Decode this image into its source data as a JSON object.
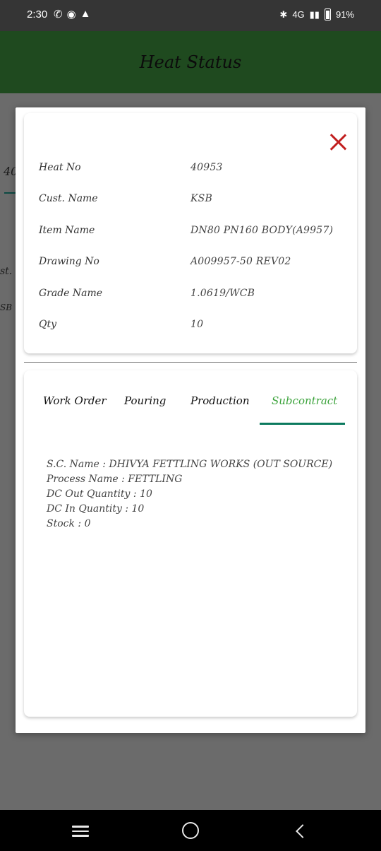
{
  "status_bar": {
    "time": "2:30",
    "left_icons": [
      "phone-icon",
      "incognito-icon",
      "warning-icon"
    ],
    "network_text": "4G",
    "battery": "91%"
  },
  "app_bar": {
    "title": "Heat Status"
  },
  "background": {
    "frag1": "40",
    "frag2": "st.",
    "frag3": "SB"
  },
  "info": {
    "heat_no": {
      "label": "Heat No",
      "value": "40953"
    },
    "cust_name": {
      "label": "Cust. Name",
      "value": "KSB"
    },
    "item_name": {
      "label": "Item Name",
      "value": "DN80 PN160 BODY(A9957)"
    },
    "drawing_no": {
      "label": "Drawing No",
      "value": "A009957-50 REV02"
    },
    "grade_name": {
      "label": "Grade Name",
      "value": "1.0619/WCB"
    },
    "qty": {
      "label": "Qty",
      "value": "10"
    }
  },
  "tabs": {
    "work_order": "Work Order",
    "pouring": "Pouring",
    "production": "Production",
    "subcontract": "Subcontract",
    "active": "Subcontract"
  },
  "subcontract": {
    "sc_name": "S.C. Name : DHIVYA FETTLING WORKS (OUT SOURCE)",
    "process_name": "Process Name : FETTLING",
    "dc_out_qty": "DC Out Quantity : 10",
    "dc_in_qty": "DC In Quantity : 10",
    "stock": "Stock : 0"
  },
  "colors": {
    "accent": "#3aa23a",
    "indicator": "#0b7a5e",
    "close": "#c21f1f",
    "app_bar": "#1f4a1f"
  }
}
